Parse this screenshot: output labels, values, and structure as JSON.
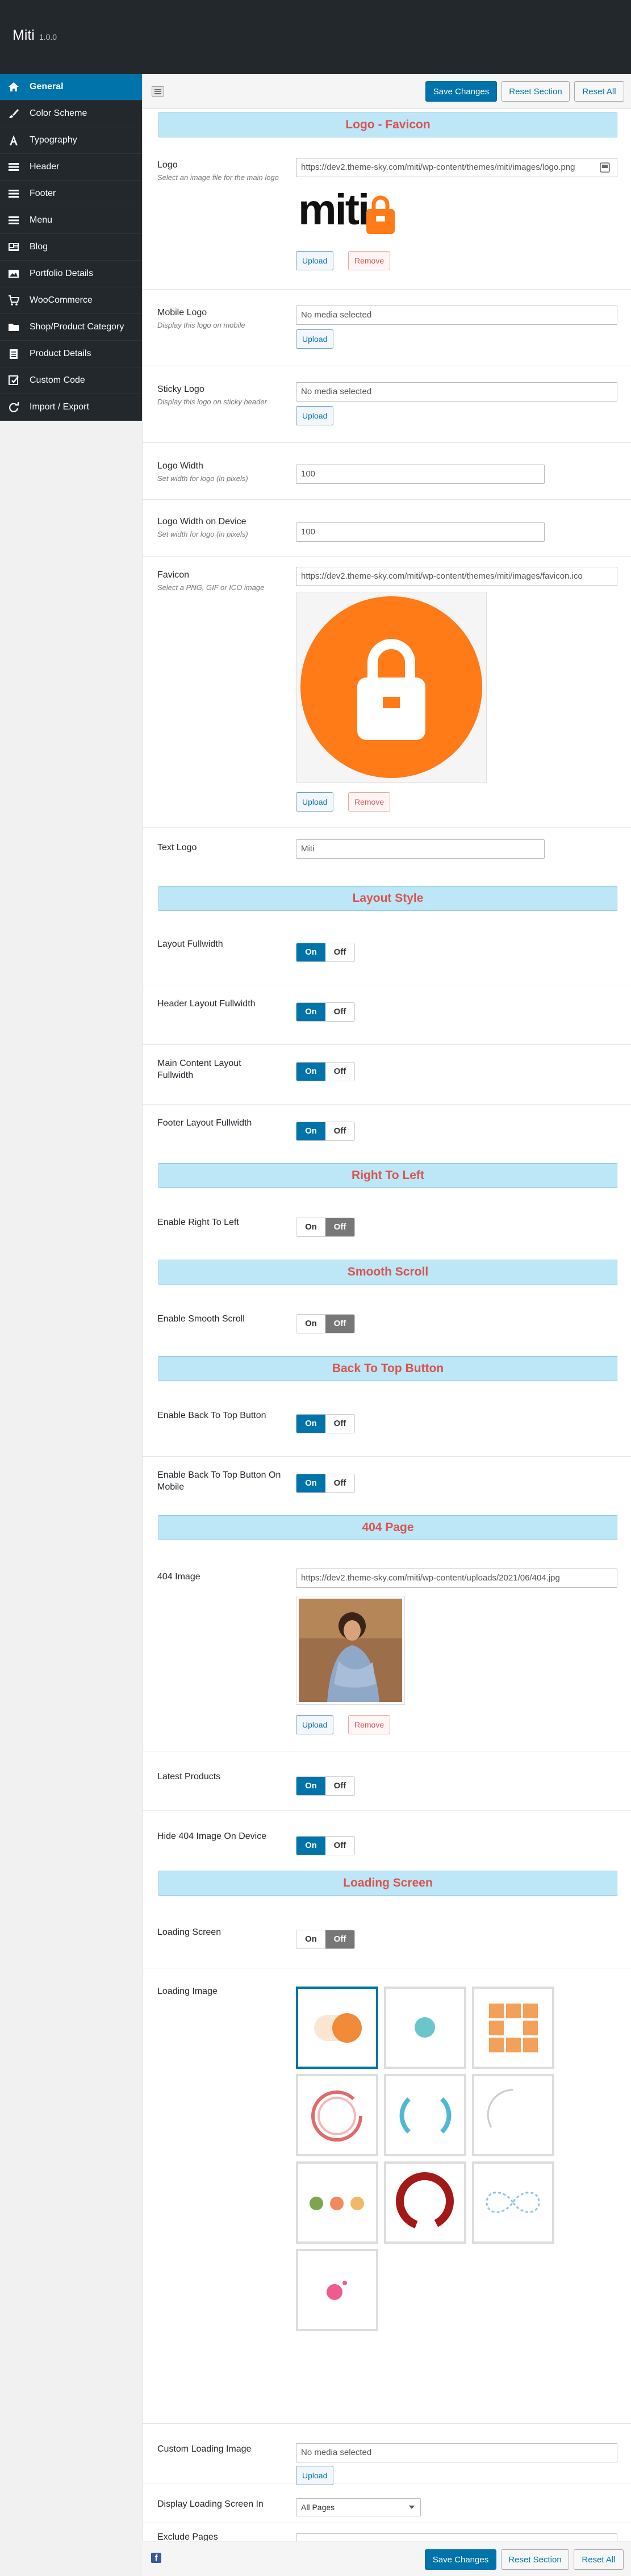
{
  "app": {
    "title": "Miti",
    "version": "1.0.0"
  },
  "sidebar": {
    "items": [
      {
        "label": "General",
        "icon": "home-icon",
        "active": true
      },
      {
        "label": "Color Scheme",
        "icon": "brush-icon"
      },
      {
        "label": "Typography",
        "icon": "typography-icon"
      },
      {
        "label": "Header",
        "icon": "menu-lines-icon"
      },
      {
        "label": "Footer",
        "icon": "menu-lines-icon"
      },
      {
        "label": "Menu",
        "icon": "menu-lines-icon"
      },
      {
        "label": "Blog",
        "icon": "blog-icon"
      },
      {
        "label": "Portfolio Details",
        "icon": "image-icon"
      },
      {
        "label": "WooCommerce",
        "icon": "cart-icon"
      },
      {
        "label": "Shop/Product Category",
        "icon": "folder-icon"
      },
      {
        "label": "Product Details",
        "icon": "clipboard-icon"
      },
      {
        "label": "Custom Code",
        "icon": "edit-icon"
      },
      {
        "label": "Import / Export",
        "icon": "refresh-icon"
      }
    ]
  },
  "toolbar": {
    "save": "Save Changes",
    "reset_section": "Reset Section",
    "reset_all": "Reset All"
  },
  "sections": {
    "logo": "Logo - Favicon",
    "layout": "Layout Style",
    "rtl": "Right To Left",
    "smooth": "Smooth Scroll",
    "backtop": "Back To Top Button",
    "p404": "404 Page",
    "loading": "Loading Screen"
  },
  "fields": {
    "logo": {
      "label": "Logo",
      "desc": "Select an image file for the main logo",
      "value": "https://dev2.theme-sky.com/miti/wp-content/themes/miti/images/logo.png",
      "logo_text": "miti"
    },
    "mobile_logo": {
      "label": "Mobile Logo",
      "desc": "Display this logo on mobile",
      "placeholder": "No media selected"
    },
    "sticky_logo": {
      "label": "Sticky Logo",
      "desc": "Display this logo on sticky header",
      "placeholder": "No media selected"
    },
    "logo_width": {
      "label": "Logo Width",
      "desc": "Set width for logo (in pixels)",
      "value": "100"
    },
    "logo_width_device": {
      "label": "Logo Width on Device",
      "desc": "Set width for logo (in pixels)",
      "value": "100"
    },
    "favicon": {
      "label": "Favicon",
      "desc": "Select a PNG, GIF or ICO image",
      "value": "https://dev2.theme-sky.com/miti/wp-content/themes/miti/images/favicon.ico"
    },
    "text_logo": {
      "label": "Text Logo",
      "value": "Miti"
    },
    "layout_fullwidth": {
      "label": "Layout Fullwidth",
      "state": "on"
    },
    "header_fullwidth": {
      "label": "Header Layout Fullwidth",
      "state": "on"
    },
    "main_fullwidth": {
      "label": "Main Content Layout Fullwidth",
      "state": "on"
    },
    "footer_fullwidth": {
      "label": "Footer Layout Fullwidth",
      "state": "on"
    },
    "rtl": {
      "label": "Enable Right To Left",
      "state": "off"
    },
    "smooth": {
      "label": "Enable Smooth Scroll",
      "state": "off"
    },
    "backtop": {
      "label": "Enable Back To Top Button",
      "state": "on"
    },
    "backtop_mobile": {
      "label": "Enable Back To Top Button On Mobile",
      "state": "on"
    },
    "img404": {
      "label": "404 Image",
      "value": "https://dev2.theme-sky.com/miti/wp-content/uploads/2021/06/404.jpg"
    },
    "latest_products": {
      "label": "Latest Products",
      "state": "on"
    },
    "hide404": {
      "label": "Hide 404 Image On Device",
      "state": "on"
    },
    "loading_screen": {
      "label": "Loading Screen",
      "state": "off"
    },
    "loading_image": {
      "label": "Loading Image",
      "selected": 1
    },
    "custom_loading": {
      "label": "Custom Loading Image",
      "placeholder": "No media selected"
    },
    "display_in": {
      "label": "Display Loading Screen In",
      "value": "All Pages"
    },
    "exclude_pages": {
      "label": "Exclude Pages",
      "value": ""
    }
  },
  "buttons": {
    "upload": "Upload",
    "remove": "Remove"
  },
  "toggle": {
    "on": "On",
    "off": "Off"
  },
  "colors": {
    "accent": "#0073aa",
    "brand_orange": "#ff7b18",
    "sidebar_bg": "#23282d",
    "section_bg": "#bde6f6",
    "section_text": "#d9534f"
  }
}
